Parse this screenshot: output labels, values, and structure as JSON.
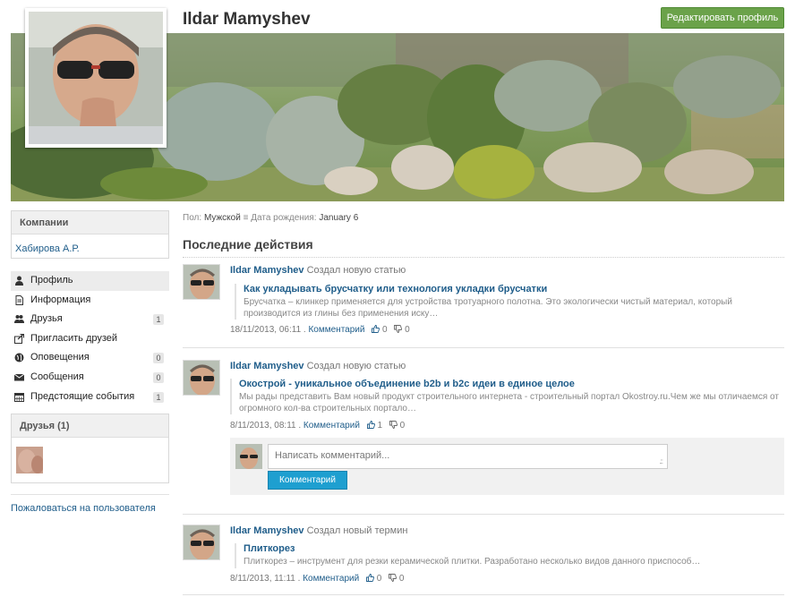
{
  "profile": {
    "name": "Ildar Mamyshev",
    "edit_label": "Редактировать профиль"
  },
  "meta": {
    "gender_label": "Пол:",
    "gender_value": "Мужской",
    "birth_label": "Дата рождения:",
    "birth_value": "January 6"
  },
  "sidebar": {
    "companies_title": "Компании",
    "companies_link": "Хабирова А.Р.",
    "menu": [
      {
        "label": "Профиль",
        "icon": "user-icon",
        "count": ""
      },
      {
        "label": "Информация",
        "icon": "document-icon",
        "count": ""
      },
      {
        "label": "Друзья",
        "icon": "users-icon",
        "count": "1"
      },
      {
        "label": "Пригласить друзей",
        "icon": "share-icon",
        "count": ""
      },
      {
        "label": "Оповещения",
        "icon": "globe-icon",
        "count": "0"
      },
      {
        "label": "Сообщения",
        "icon": "envelope-icon",
        "count": "0"
      },
      {
        "label": "Предстоящие события",
        "icon": "calendar-icon",
        "count": "1"
      }
    ],
    "friends_title": "Друзья (1)",
    "report_link": "Пожаловаться на пользователя"
  },
  "activity": {
    "title": "Последние действия",
    "items": [
      {
        "author": "Ildar Mamyshev",
        "action": "Создал новую статью",
        "link": "Как укладывать брусчатку или технология укладки брусчатки",
        "desc": "Брусчатка – клинкер применяется для устройства тротуарного полотна. Это экологически чистый материал, который производится из глины без применения иску…",
        "date": "18/11/2013, 06:11 .",
        "comment": "Комментарий",
        "likes": "0",
        "dislikes": "0"
      },
      {
        "author": "Ildar Mamyshev",
        "action": "Создал новую статью",
        "link": "Окострой - уникальное объединение b2b и b2c идеи в единое целое",
        "desc": "Мы рады представить Вам новый продукт строительного интернета - строительный портал Okostroy.ru.Чем же мы отличаемся от огромного кол-ва строительных портало…",
        "date": "8/11/2013, 08:11 .",
        "comment": "Комментарий",
        "likes": "1",
        "dislikes": "0"
      },
      {
        "author": "Ildar Mamyshev",
        "action": "Создал новый термин",
        "link": "Плиткорез",
        "desc": "Плиткорез – инструмент для резки керамической плитки. Разработано несколько видов данного приспособ…",
        "date": "8/11/2013, 11:11 .",
        "comment": "Комментарий",
        "likes": "0",
        "dislikes": "0"
      }
    ]
  },
  "comment_form": {
    "placeholder": "Написать комментарий...",
    "submit_label": "Комментарий"
  }
}
